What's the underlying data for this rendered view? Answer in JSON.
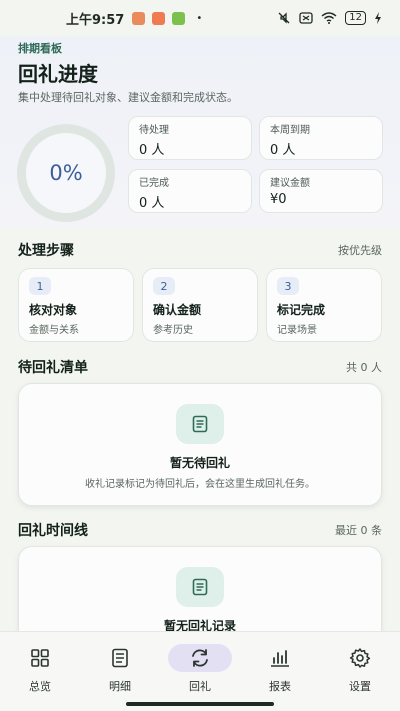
{
  "status_bar": {
    "time": "上午9:57",
    "battery": "12",
    "app_colors": [
      "#e98b5c",
      "#f07a52",
      "#7cc04e"
    ]
  },
  "header": {
    "kicker": "排期看板",
    "title": "回礼进度",
    "subtitle": "集中处理待回礼对象、建议金额和完成状态。"
  },
  "progress": {
    "value": "0%"
  },
  "stats": [
    {
      "label": "待处理",
      "value": "0 人"
    },
    {
      "label": "本周到期",
      "value": "0 人"
    },
    {
      "label": "已完成",
      "value": "0 人"
    },
    {
      "label": "建议金额",
      "value": "¥0"
    }
  ],
  "steps_section": {
    "title": "处理步骤",
    "meta": "按优先级",
    "steps": [
      {
        "num": "1",
        "title": "核对对象",
        "sub": "金额与关系"
      },
      {
        "num": "2",
        "title": "确认金额",
        "sub": "参考历史"
      },
      {
        "num": "3",
        "title": "标记完成",
        "sub": "记录场景"
      }
    ]
  },
  "pending_section": {
    "title": "待回礼清单",
    "meta": "共 0 人",
    "empty_title": "暂无待回礼",
    "empty_desc": "收礼记录标记为待回礼后，会在这里生成回礼任务。"
  },
  "timeline_section": {
    "title": "回礼时间线",
    "meta": "最近 0 条",
    "empty_title": "暂无回礼记录"
  },
  "nav": {
    "items": [
      {
        "label": "总览",
        "icon": "grid-icon"
      },
      {
        "label": "明细",
        "icon": "list-icon"
      },
      {
        "label": "回礼",
        "icon": "refresh-icon"
      },
      {
        "label": "报表",
        "icon": "bar-chart-icon"
      },
      {
        "label": "设置",
        "icon": "gear-icon"
      }
    ],
    "active": "回礼"
  },
  "colors": {
    "accent": "#3b5f9a",
    "brand_green": "#2f6b57",
    "active_nav_bg": "#e3e0f3"
  }
}
